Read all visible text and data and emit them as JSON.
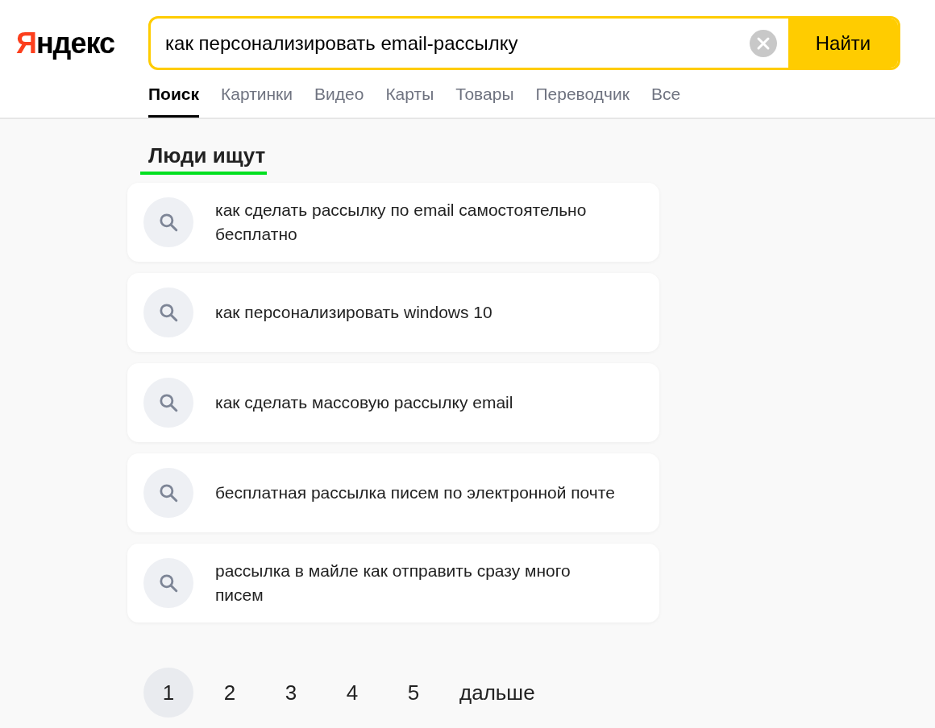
{
  "logo": "Яндекс",
  "search": {
    "value": "как персонализировать email-рассылку",
    "button": "Найти"
  },
  "tabs": [
    {
      "label": "Поиск",
      "selected": true
    },
    {
      "label": "Картинки",
      "selected": false
    },
    {
      "label": "Видео",
      "selected": false
    },
    {
      "label": "Карты",
      "selected": false
    },
    {
      "label": "Товары",
      "selected": false
    },
    {
      "label": "Переводчик",
      "selected": false
    },
    {
      "label": "Все",
      "selected": false
    }
  ],
  "people_search": {
    "title": "Люди ищут",
    "items": [
      "как сделать рассылку по email самостоятельно бесплатно",
      "как персонализировать windows 10",
      "как сделать массовую рассылку email",
      "бесплатная рассылка писем по электронной почте",
      "рассылка в майле как отправить сразу много писем"
    ]
  },
  "pagination": {
    "pages": [
      {
        "label": "1",
        "selected": true
      },
      {
        "label": "2",
        "selected": false
      },
      {
        "label": "3",
        "selected": false
      },
      {
        "label": "4",
        "selected": false
      },
      {
        "label": "5",
        "selected": false
      }
    ],
    "next": "дальше"
  }
}
